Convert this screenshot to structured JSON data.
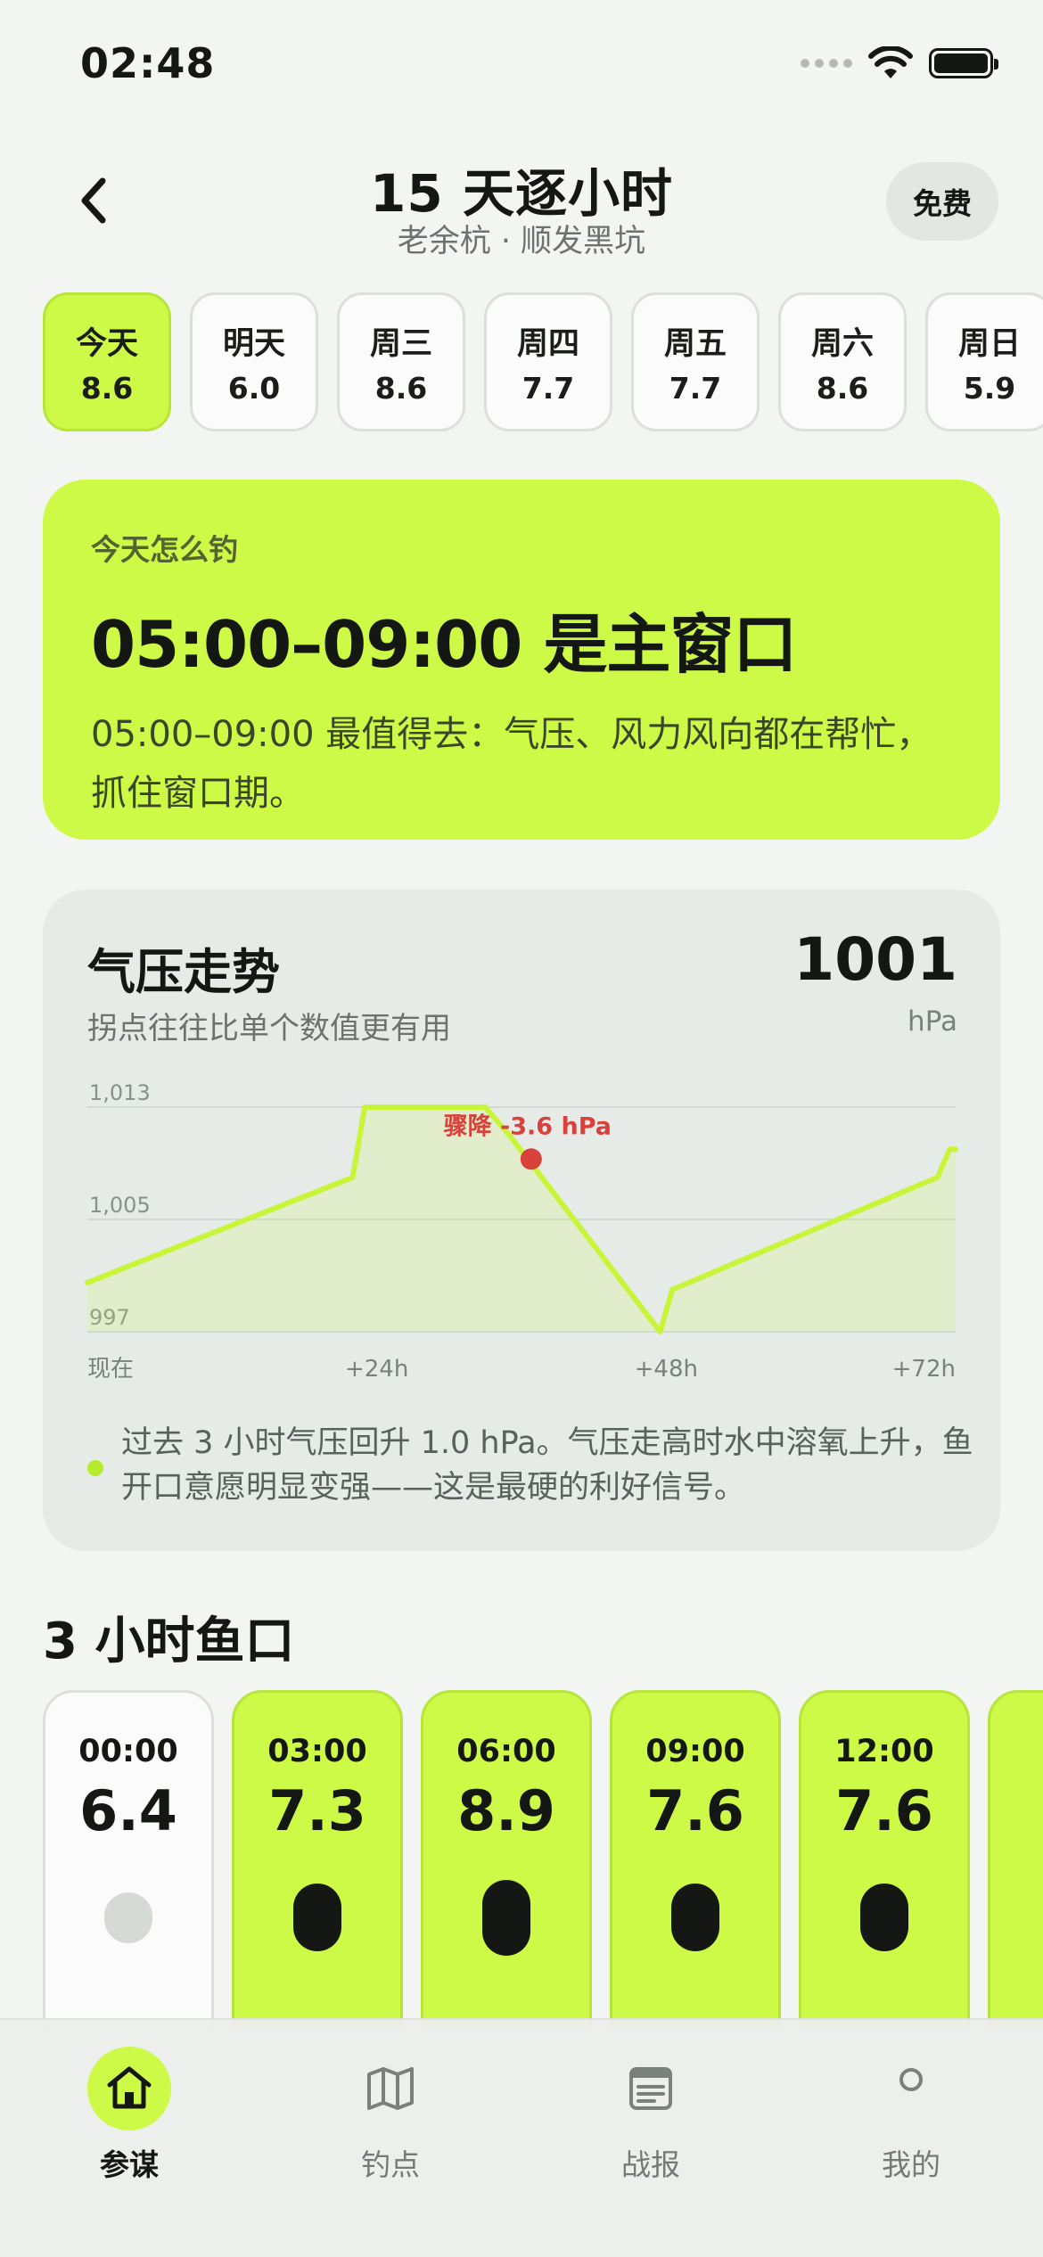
{
  "status_bar": {
    "time": "02:48"
  },
  "header": {
    "title": "15 天逐小时",
    "subtitle": "老余杭 · 顺发黑坑",
    "badge": "免费"
  },
  "day_tabs": [
    {
      "label": "今天",
      "score": "8.6",
      "active": true
    },
    {
      "label": "明天",
      "score": "6.0",
      "active": false
    },
    {
      "label": "周三",
      "score": "8.6",
      "active": false
    },
    {
      "label": "周四",
      "score": "7.7",
      "active": false
    },
    {
      "label": "周五",
      "score": "7.7",
      "active": false
    },
    {
      "label": "周六",
      "score": "8.6",
      "active": false
    },
    {
      "label": "周日",
      "score": "5.9",
      "active": false
    }
  ],
  "hero": {
    "eyebrow": "今天怎么钓",
    "title": "05:00–09:00 是主窗口",
    "description": "05:00–09:00 最值得去：气压、风力风向都在帮忙，抓住窗口期。"
  },
  "pressure": {
    "title": "气压走势",
    "subtitle": "拐点往往比单个数值更有用",
    "current_value": "1001",
    "unit": "hPa",
    "note": "过去 3 小时气压回升 1.0 hPa。气压走高时水中溶氧上升，鱼开口意愿明显变强——这是最硬的利好信号。"
  },
  "chart_data": {
    "type": "area",
    "title": "",
    "xlabel": "",
    "ylabel": "",
    "ylim": [
      997,
      1013
    ],
    "y_ticks": [
      "1,013",
      "1,005",
      "997"
    ],
    "y_tick_values": [
      1013,
      1005,
      997
    ],
    "x_ticks": [
      "现在",
      "+24h",
      "+48h",
      "+72h"
    ],
    "x_tick_values": [
      0,
      24,
      48,
      72
    ],
    "xlim": [
      0,
      72
    ],
    "grid": true,
    "series": [
      {
        "x": [
          0,
          22,
          23,
          33,
          35,
          47.5,
          48.5,
          70.5,
          71.5,
          72
        ],
        "y": [
          1000.5,
          1008,
          1013,
          1013,
          1011,
          997,
          1000,
          1008,
          1010,
          1010
        ]
      }
    ],
    "annotation": {
      "label": "骤降 -3.6 hPa",
      "x": 36.8,
      "y": 1009.3
    },
    "colors": {
      "line": "#c8f53a",
      "marker": "#d9423b",
      "annotation_text": "#d9423b"
    }
  },
  "hourly": {
    "title": "3 小时鱼口",
    "items": [
      {
        "time": "00:00",
        "score": "6.4",
        "level": 0.28,
        "highlight": false
      },
      {
        "time": "03:00",
        "score": "7.3",
        "level": 0.6,
        "highlight": true
      },
      {
        "time": "06:00",
        "score": "8.9",
        "level": 0.75,
        "highlight": true
      },
      {
        "time": "09:00",
        "score": "7.6",
        "level": 0.6,
        "highlight": true
      },
      {
        "time": "12:00",
        "score": "7.6",
        "level": 0.6,
        "highlight": true
      },
      {
        "time": "",
        "score": "",
        "level": 0,
        "highlight": true
      }
    ]
  },
  "tab_bar": [
    {
      "label": "参谋",
      "icon": "home-icon",
      "active": true
    },
    {
      "label": "钓点",
      "icon": "map-icon",
      "active": false
    },
    {
      "label": "战报",
      "icon": "report-icon",
      "active": false
    },
    {
      "label": "我的",
      "icon": "profile-icon",
      "active": false
    }
  ],
  "theme": {
    "accent": "#cdfa47",
    "text": "#141714"
  }
}
